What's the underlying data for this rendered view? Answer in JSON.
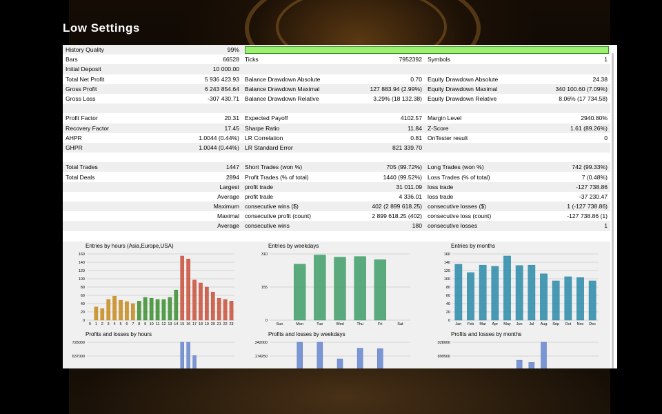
{
  "page_title": "Low Settings",
  "stats_rows": [
    [
      "History Quality",
      "99%",
      "",
      "",
      "",
      ""
    ],
    [
      "Bars",
      "66528",
      "Ticks",
      "7952392",
      "Symbols",
      "1"
    ],
    [
      "Initial Deposit",
      "10 000.00",
      "",
      "",
      "",
      ""
    ],
    [
      "Total Net Profit",
      "5 936 423.93",
      "Balance Drawdown Absolute",
      "0.70",
      "Equity Drawdown Absolute",
      "24.38"
    ],
    [
      "Gross Profit",
      "6 243 854.64",
      "Balance Drawdown Maximal",
      "127 883.94 (2.99%)",
      "Equity Drawdown Maximal",
      "340 100.60 (7.09%)"
    ],
    [
      "Gross Loss",
      "-307 430.71",
      "Balance Drawdown Relative",
      "3.29% (18 132.38)",
      "Equity Drawdown Relative",
      "8.06% (17 734.58)"
    ],
    [
      "",
      "",
      "",
      "",
      "",
      ""
    ],
    [
      "Profit Factor",
      "20.31",
      "Expected Payoff",
      "4102.57",
      "Margin Level",
      "2940.80%"
    ],
    [
      "Recovery Factor",
      "17.45",
      "Sharpe Ratio",
      "11.84",
      "Z-Score",
      "1.61 (89.26%)"
    ],
    [
      "AHPR",
      "1.0044 (0.44%)",
      "LR Correlation",
      "0.81",
      "OnTester result",
      "0"
    ],
    [
      "GHPR",
      "1.0044 (0.44%)",
      "LR Standard Error",
      "821 339.70",
      "",
      ""
    ],
    [
      "",
      "",
      "",
      "",
      "",
      ""
    ],
    [
      "Total Trades",
      "1447",
      "Short Trades (won %)",
      "705 (99.72%)",
      "Long Trades (won %)",
      "742 (99.33%)"
    ],
    [
      "Total Deals",
      "2894",
      "Profit Trades (% of total)",
      "1440 (99.52%)",
      "Loss Trades (% of total)",
      "7 (0.48%)"
    ],
    [
      "",
      "Largest",
      "profit trade",
      "31 011.09",
      "loss trade",
      "-127 738.86"
    ],
    [
      "",
      "Average",
      "profit trade",
      "4 336.01",
      "loss trade",
      "-37 230.47"
    ],
    [
      "",
      "Maximum",
      "consecutive wins ($)",
      "402 (2 899 618.25)",
      "consecutive losses ($)",
      "1 (-127 738.86)"
    ],
    [
      "",
      "Maximal",
      "consecutive profit (count)",
      "2 899 618.25 (402)",
      "consecutive loss (count)",
      "-127 738.86 (1)"
    ],
    [
      "",
      "Average",
      "consecutive wins",
      "180",
      "consecutive losses",
      "1"
    ],
    [
      "",
      "",
      "",
      "",
      "",
      ""
    ]
  ],
  "history_quality_fraction": 1.0,
  "chart_data": [
    {
      "type": "bar",
      "title": "Entries by hours (Asia,Europe,USA)",
      "categories": [
        "0",
        "1",
        "2",
        "3",
        "4",
        "5",
        "6",
        "7",
        "8",
        "9",
        "10",
        "11",
        "12",
        "13",
        "14",
        "15",
        "16",
        "17",
        "18",
        "19",
        "20",
        "21",
        "22",
        "23"
      ],
      "values": [
        0,
        32,
        28,
        50,
        58,
        48,
        45,
        40,
        46,
        55,
        53,
        50,
        50,
        55,
        73,
        155,
        148,
        97,
        90,
        80,
        68,
        53,
        50,
        46
      ],
      "ylim": [
        0,
        160
      ],
      "yticks": [
        "0",
        "20",
        "40",
        "60",
        "80",
        "100",
        "120",
        "140",
        "160"
      ],
      "colors": [
        "#c68a1c",
        "#c68a1c",
        "#c68a1c",
        "#c68a1c",
        "#c68a1c",
        "#c68a1c",
        "#c68a1c",
        "#c68a1c",
        "#3a8d2e",
        "#3a8d2e",
        "#3a8d2e",
        "#3a8d2e",
        "#3a8d2e",
        "#3a8d2e",
        "#3a8d2e",
        "#c8503a",
        "#c8503a",
        "#c8503a",
        "#c8503a",
        "#c8503a",
        "#c8503a",
        "#c8503a",
        "#c8503a",
        "#c8503a"
      ]
    },
    {
      "type": "bar",
      "title": "Entries by weekdays",
      "categories": [
        "Sun",
        "Mon",
        "Tue",
        "Wed",
        "Thu",
        "Fri",
        "Sat"
      ],
      "values": [
        0,
        262,
        305,
        295,
        298,
        283,
        0
      ],
      "ylim": [
        0,
        310
      ],
      "yticks": [
        "0",
        "155",
        "310"
      ],
      "color": "#3f9e69"
    },
    {
      "type": "bar",
      "title": "Entries by months",
      "categories": [
        "Jan",
        "Feb",
        "Mar",
        "Apr",
        "May",
        "Jun",
        "Jul",
        "Aug",
        "Sep",
        "Oct",
        "Nov",
        "Dec"
      ],
      "values": [
        135,
        115,
        133,
        130,
        155,
        132,
        133,
        112,
        95,
        105,
        103,
        95
      ],
      "ylim": [
        0,
        160
      ],
      "yticks": [
        "0",
        "20",
        "40",
        "60",
        "80",
        "100",
        "120",
        "140",
        "160"
      ],
      "color": "#2a8aa8"
    },
    {
      "type": "bar",
      "title": "Profits and losses by hours",
      "yticks_visible": [
        "728000",
        "637000",
        "546000",
        "455000"
      ],
      "ylim": [
        455000,
        728000
      ],
      "bars_x_category_index": [
        15,
        16,
        17
      ],
      "values": [
        728000,
        728000,
        640000
      ],
      "color": "#7b96d4"
    },
    {
      "type": "bar",
      "title": "Profits and losses by weekdays",
      "yticks_visible": [
        "1342000",
        "1174250",
        "1006500",
        "838750"
      ],
      "ylim": [
        838750,
        1342000
      ],
      "bars_x_category_index": [
        1,
        2,
        3,
        4,
        5
      ],
      "values": [
        1342000,
        1342000,
        1140000,
        1270000,
        1265000
      ],
      "color": "#7b96d4"
    },
    {
      "type": "bar",
      "title": "Profits and losses by months",
      "yticks_visible": [
        "1028000",
        "899500",
        "771000",
        "642500"
      ],
      "ylim": [
        642500,
        1028000
      ],
      "bars_x_category_index": [
        4,
        5,
        6,
        7,
        8
      ],
      "values": [
        680000,
        860000,
        840000,
        1028000,
        660000
      ],
      "color": "#7b96d4"
    }
  ]
}
